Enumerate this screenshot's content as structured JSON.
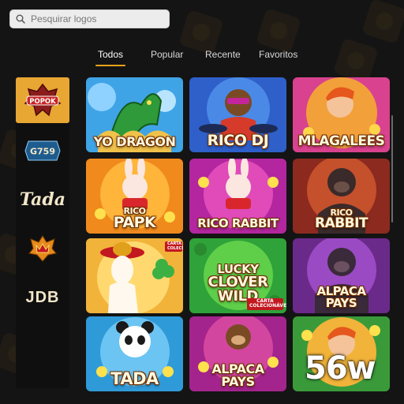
{
  "search": {
    "placeholder": "Pesquirar logos"
  },
  "tabs": [
    {
      "label": "Todos",
      "active": true
    },
    {
      "label": "Popular",
      "active": false
    },
    {
      "label": "Recente",
      "active": false
    },
    {
      "label": "Favoritos",
      "active": false
    }
  ],
  "providers": [
    {
      "label": "POPOK",
      "active": true
    },
    {
      "label": "G759",
      "active": false
    },
    {
      "label": "Tada",
      "active": false
    },
    {
      "label": "",
      "icon": "crown-badge-icon",
      "active": false
    },
    {
      "label": "JDB",
      "active": false
    }
  ],
  "games": [
    {
      "title": "YO DRAGON",
      "character": "dragon-icon"
    },
    {
      "title": "RICO DJ",
      "character": "monkey-dj-icon"
    },
    {
      "title": "MLAGALEES",
      "character": "boy-icon"
    },
    {
      "title_line1": "RICO",
      "title_line2": "PAPK",
      "character": "rabbit-icon"
    },
    {
      "title": "RICO RABBIT",
      "character": "rabbit-icon"
    },
    {
      "title_line1": "RICO",
      "title_line2": "RABBIT",
      "character": "gorilla-icon"
    },
    {
      "title": "",
      "tag": "CARTA COLECIONÁVEL",
      "character": "alpaca-icon"
    },
    {
      "title_line1": "LUCKY",
      "title_line2": "CLOVER",
      "title_line3": "WILD",
      "tag": "CARTA COLECIONÁVELE",
      "character": "clover-icon"
    },
    {
      "title_line1": "ALPACA",
      "title_line2": "PAYS",
      "character": "gorilla-icon"
    },
    {
      "title": "TADA",
      "character": "panda-icon"
    },
    {
      "title_line1": "ALPACA",
      "title_line2": "PAYS",
      "character": "monkey-icon"
    },
    {
      "title": "",
      "character": "boy-icon"
    }
  ],
  "watermark": "56w",
  "colors": {
    "accent": "#e8a21b",
    "background": "#141414",
    "sidebar": "#0f0f0f"
  }
}
